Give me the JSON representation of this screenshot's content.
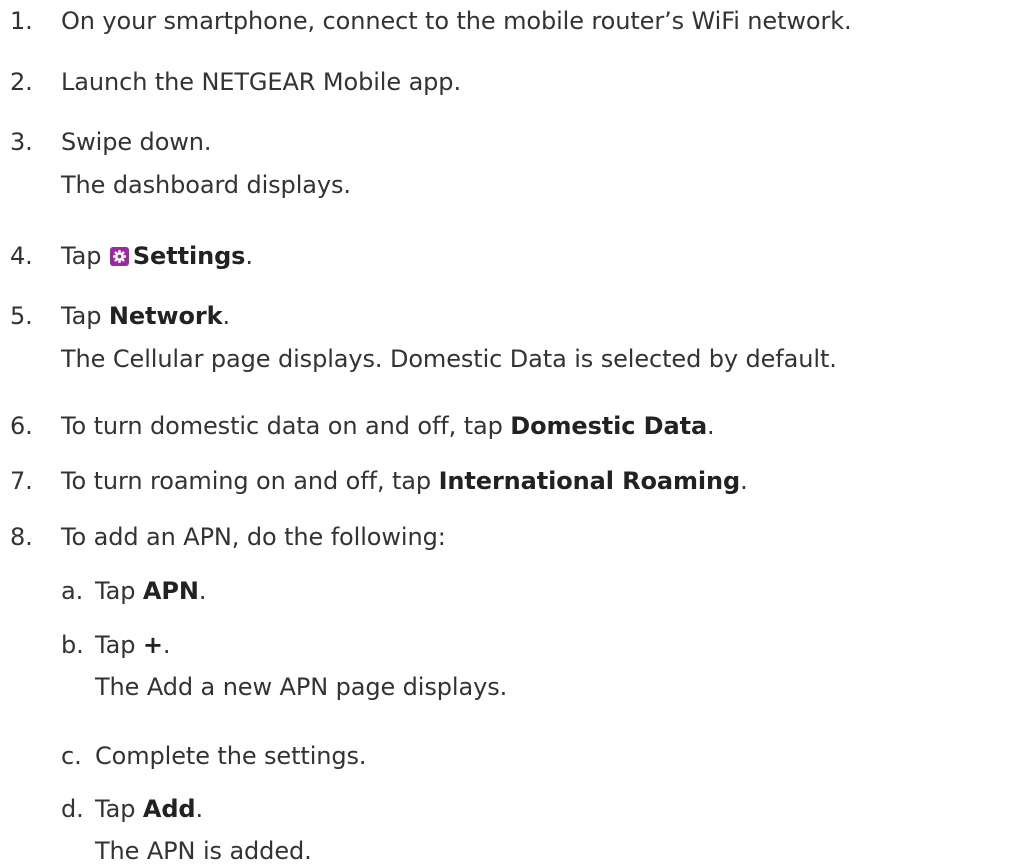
{
  "steps": {
    "s1": {
      "num": "1.",
      "text": "On your smartphone, connect to the mobile router’s WiFi network."
    },
    "s2": {
      "num": "2.",
      "text": "Launch the NETGEAR Mobile app."
    },
    "s3": {
      "num": "3.",
      "text": "Swipe down.",
      "result": "The dashboard displays."
    },
    "s4": {
      "num": "4.",
      "pre": "Tap ",
      "bold": "Settings",
      "post": "."
    },
    "s5": {
      "num": "5.",
      "pre": "Tap ",
      "bold": "Network",
      "post": ".",
      "result": "The Cellular page displays. Domestic Data is selected by default."
    },
    "s6": {
      "num": "6.",
      "pre": "To turn domestic data on and off, tap ",
      "bold": "Domestic Data",
      "post": "."
    },
    "s7": {
      "num": "7.",
      "pre": "To turn roaming on and off, tap ",
      "bold": "International Roaming",
      "post": "."
    },
    "s8": {
      "num": "8.",
      "text": "To add an APN, do the following:",
      "a": {
        "letter": "a.",
        "pre": "Tap ",
        "bold": "APN",
        "post": "."
      },
      "b": {
        "letter": "b.",
        "pre": "Tap ",
        "bold": "+",
        "post": ".",
        "result": "The Add a new APN page displays."
      },
      "c": {
        "letter": "c.",
        "text": "Complete the settings."
      },
      "d": {
        "letter": "d.",
        "pre": "Tap ",
        "bold": "Add",
        "post": ".",
        "result": "The APN is added."
      }
    }
  },
  "icons": {
    "settings": "gear-icon"
  },
  "colors": {
    "text": "#333333",
    "icon_bg": "#9b2a9e",
    "icon_fg": "#ffffff"
  }
}
